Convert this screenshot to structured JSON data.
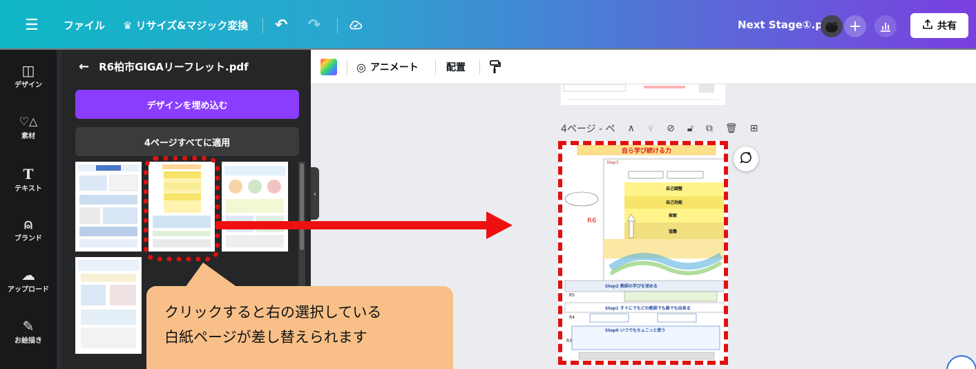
{
  "topbar": {
    "menu_icon": "hamburger-icon",
    "file_label": "ファイル",
    "resize_label": "♛ リサイズ&マジック変換",
    "doc_title": "Next Stage①.pdf",
    "share_label": "共有"
  },
  "rail": {
    "items": [
      {
        "label": "デザイン",
        "icon": "layout-icon"
      },
      {
        "label": "素材",
        "icon": "elements-icon"
      },
      {
        "label": "テキスト",
        "icon": "text-icon"
      },
      {
        "label": "ブランド",
        "icon": "brand-icon"
      },
      {
        "label": "アップロード",
        "icon": "upload-icon"
      },
      {
        "label": "お絵描き",
        "icon": "draw-icon"
      }
    ]
  },
  "panel": {
    "back_icon": "arrow-left-icon",
    "title": "R6柏市GIGAリーフレット.pdf",
    "embed_button": "デザインを埋め込む",
    "apply_all_button": "4ページすべてに適用"
  },
  "toolbar": {
    "animate_label": "アニメート",
    "position_label": "配置"
  },
  "page": {
    "label": "4ページ - ペ",
    "title": "自ら学び続ける力",
    "step3": "Step3",
    "step2": "Step2 教師の学びを深める",
    "step1": "Step1 すぐにでもどの教師でも誰でも出来る",
    "step0": "Step0 いつでもちょこっと使う",
    "r6": "R6",
    "r5": "R5",
    "r4": "R4",
    "r3": "R3",
    "levels": [
      "自己調整",
      "自己効能",
      "探索",
      "協働"
    ]
  },
  "annotation": {
    "line1": "クリックすると右の選択している",
    "line2": "白紙ページが差し替えられます"
  },
  "colors": {
    "accent_purple": "#8b3dff",
    "highlight_red": "#e01010",
    "callout_fill": "#f8c088"
  }
}
